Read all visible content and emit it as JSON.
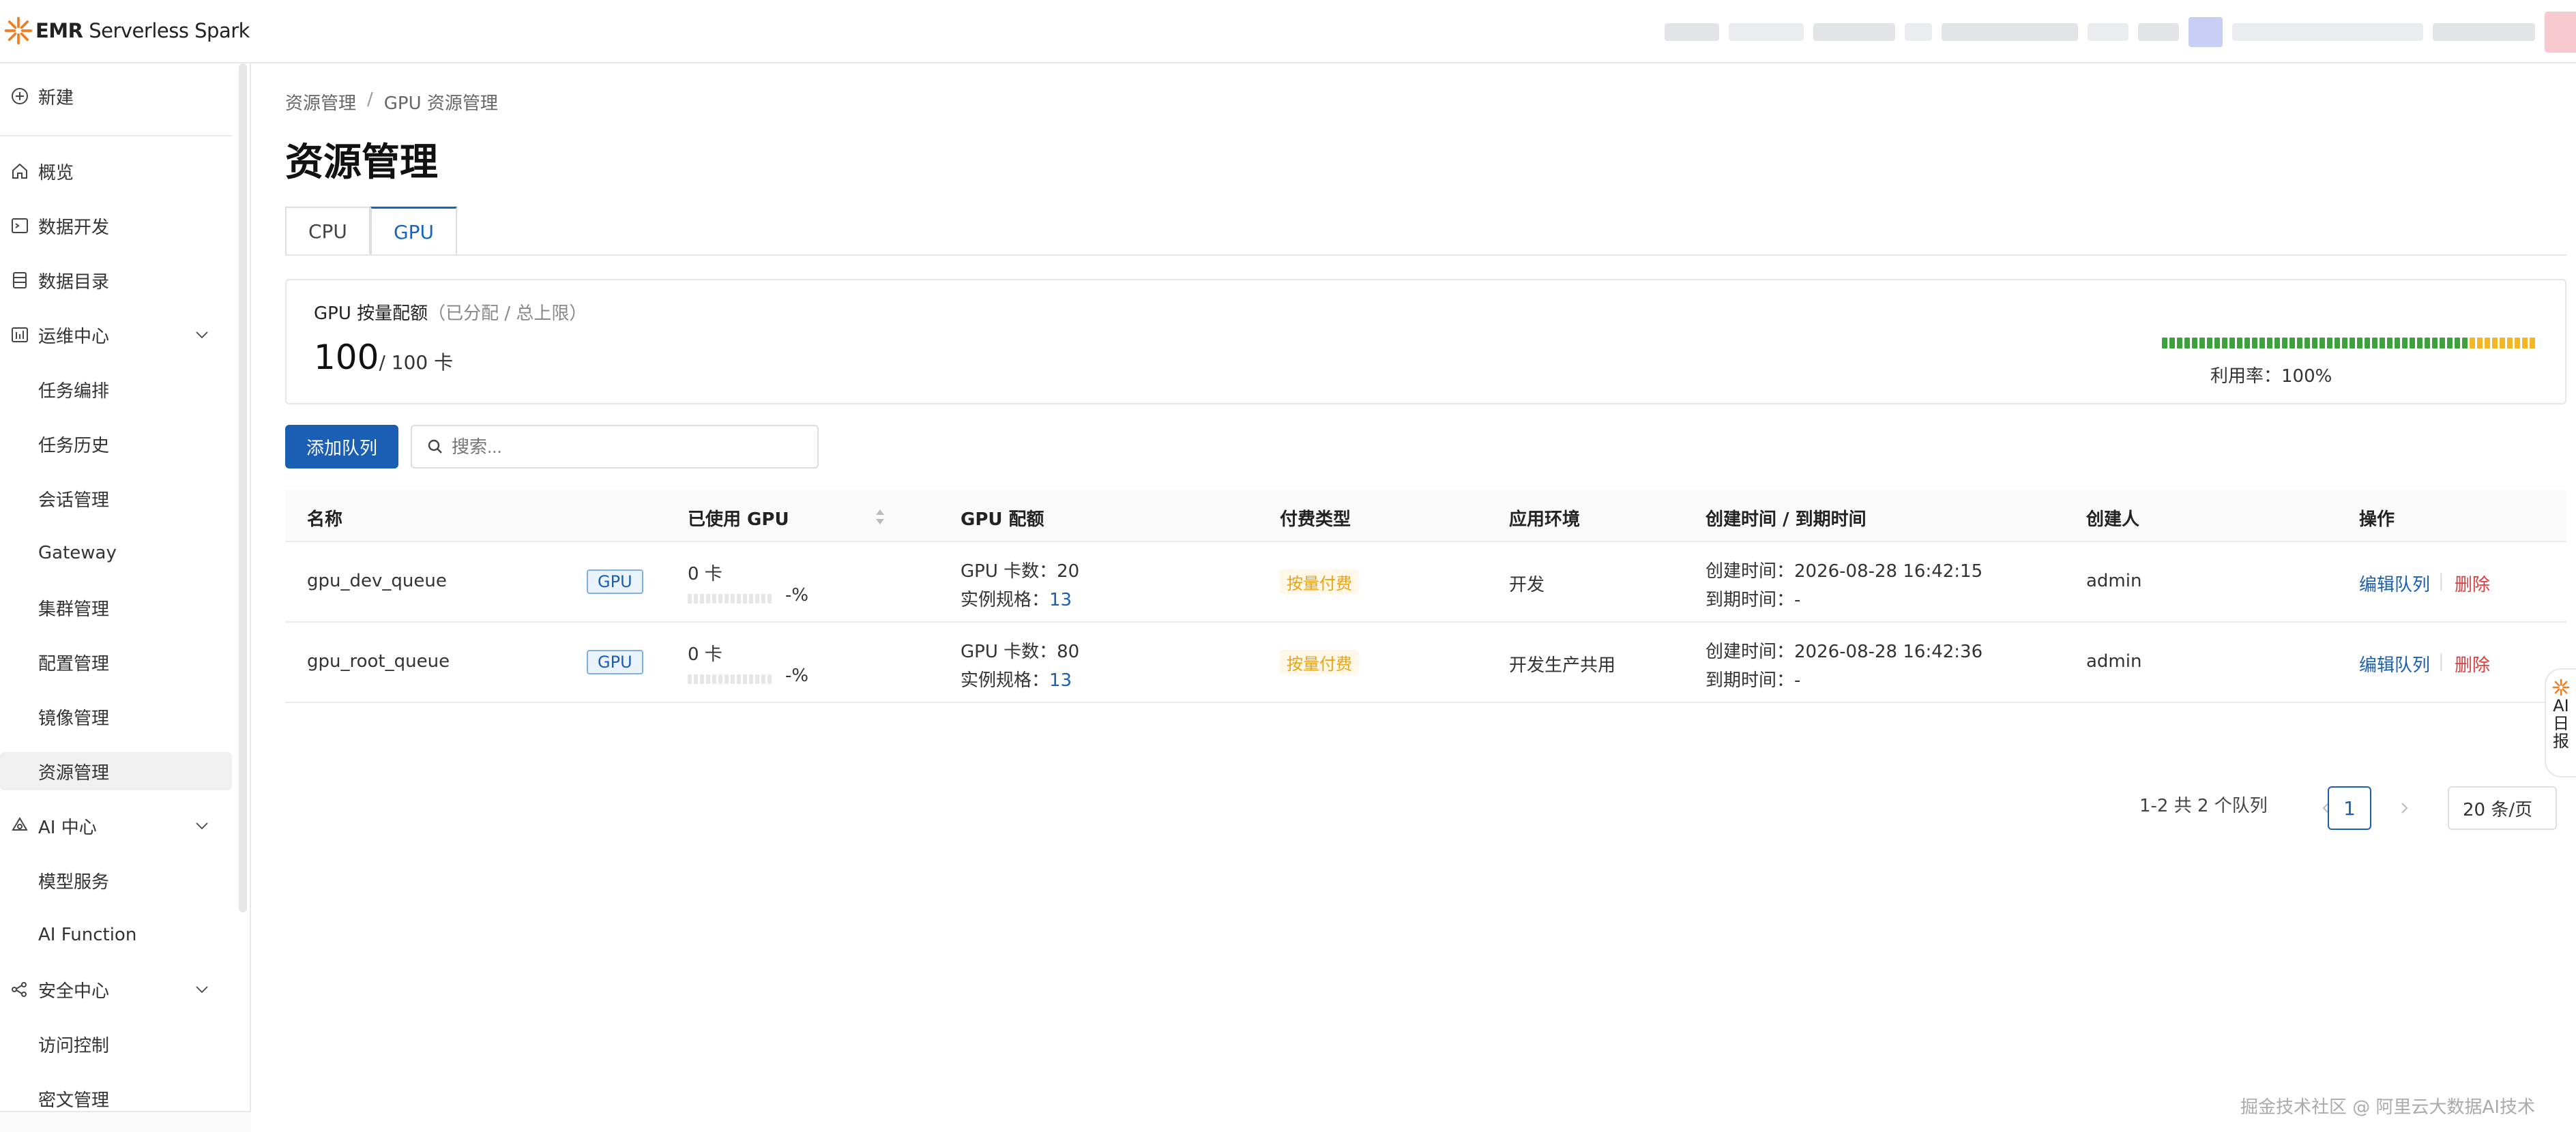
{
  "app": {
    "brand_bold": "EMR",
    "brand_rest": " Serverless Spark"
  },
  "colors": {
    "accent": "#1a5fb4",
    "brand_orange": "#f47c20",
    "danger": "#e03c3c",
    "success": "#3ca33c",
    "warning": "#f5b623"
  },
  "sidebar": {
    "new_label": "新建",
    "items": [
      {
        "label": "概览",
        "icon": "home-icon"
      },
      {
        "label": "数据开发",
        "icon": "terminal-icon"
      },
      {
        "label": "数据目录",
        "icon": "database-icon"
      },
      {
        "label": "运维中心",
        "icon": "ops-icon"
      },
      {
        "label": "任务编排"
      },
      {
        "label": "任务历史"
      },
      {
        "label": "会话管理"
      },
      {
        "label": "Gateway"
      },
      {
        "label": "集群管理"
      },
      {
        "label": "配置管理"
      },
      {
        "label": "镜像管理"
      },
      {
        "label": "资源管理"
      },
      {
        "label": "AI 中心",
        "icon": "ai-icon"
      },
      {
        "label": "模型服务"
      },
      {
        "label": "AI Function"
      },
      {
        "label": "安全中心",
        "icon": "security-icon"
      },
      {
        "label": "访问控制"
      },
      {
        "label": "密文管理"
      }
    ]
  },
  "breadcrumb": {
    "root": "资源管理",
    "sep": "/",
    "current": "GPU 资源管理"
  },
  "page": {
    "title": "资源管理"
  },
  "tabs": [
    {
      "label": "CPU"
    },
    {
      "label": "GPU"
    }
  ],
  "quota": {
    "title": "GPU 按量配额",
    "title_note": "（已分配 / 总上限）",
    "used": "100",
    "limit": "/ 100 卡",
    "utilization_label": "利用率：100%",
    "utilization": 1.0
  },
  "toolbar": {
    "add_label": "添加队列",
    "search_placeholder": "搜索..."
  },
  "table": {
    "headers": [
      "名称",
      "已使用 GPU",
      "GPU 配额",
      "付费类型",
      "应用环境",
      "创建时间 / 到期时间",
      "创建人",
      "操作"
    ],
    "rows": [
      {
        "name": "gpu_dev_queue",
        "tag": "GPU",
        "used": "0 卡",
        "pct": "-%",
        "quota_line1": "GPU 卡数：20",
        "spec_label": "实例规格：",
        "spec_value": "13",
        "pay": "按量付费",
        "env": "开发",
        "created": "创建时间：2026-08-28 16:42:15",
        "expire": "到期时间：-",
        "creator": "admin",
        "edit": "编辑队列",
        "delete": "删除"
      },
      {
        "name": "gpu_root_queue",
        "tag": "GPU",
        "used": "0 卡",
        "pct": "-%",
        "quota_line1": "GPU 卡数：80",
        "spec_label": "实例规格：",
        "spec_value": "13",
        "pay": "按量付费",
        "env": "开发生产共用",
        "created": "创建时间：2026-08-28 16:42:36",
        "expire": "到期时间：-",
        "creator": "admin",
        "edit": "编辑队列",
        "delete": "删除"
      }
    ]
  },
  "pagination": {
    "summary": "1-2 共 2 个队列",
    "current": "1",
    "page_size": "20 条/页"
  },
  "float": {
    "line1": "AI",
    "line2": "日",
    "line3": "报"
  },
  "watermark": "掘金技术社区 @ 阿里云大数据AI技术"
}
